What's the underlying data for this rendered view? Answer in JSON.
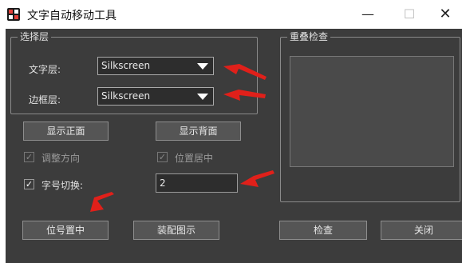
{
  "window": {
    "title": "文字自动移动工具",
    "minimize_glyph": "—",
    "maximize_glyph": "☐",
    "close_glyph": "✕"
  },
  "layer_group": {
    "title": "选择层",
    "text_layer_label": "文字层:",
    "text_layer_value": "Silkscreen",
    "border_layer_label": "边框层:",
    "border_layer_value": "Silkscreen"
  },
  "overlap_group": {
    "title": "重叠检查"
  },
  "buttons": {
    "show_front": "显示正面",
    "show_back": "显示背面",
    "position_center": "位号置中",
    "assembly_drawing": "装配图示",
    "check": "检查",
    "close": "关闭"
  },
  "options": {
    "adjust_direction": {
      "label": "调整方向",
      "checked": true,
      "enabled": false
    },
    "center_position": {
      "label": "位置居中",
      "checked": true,
      "enabled": false
    },
    "font_size_switch": {
      "label": "字号切换:",
      "checked": true,
      "enabled": true
    },
    "font_size_value": "2"
  },
  "colors": {
    "panel_bg": "#3c3c3c",
    "annotation_arrow": "#e0201a"
  }
}
